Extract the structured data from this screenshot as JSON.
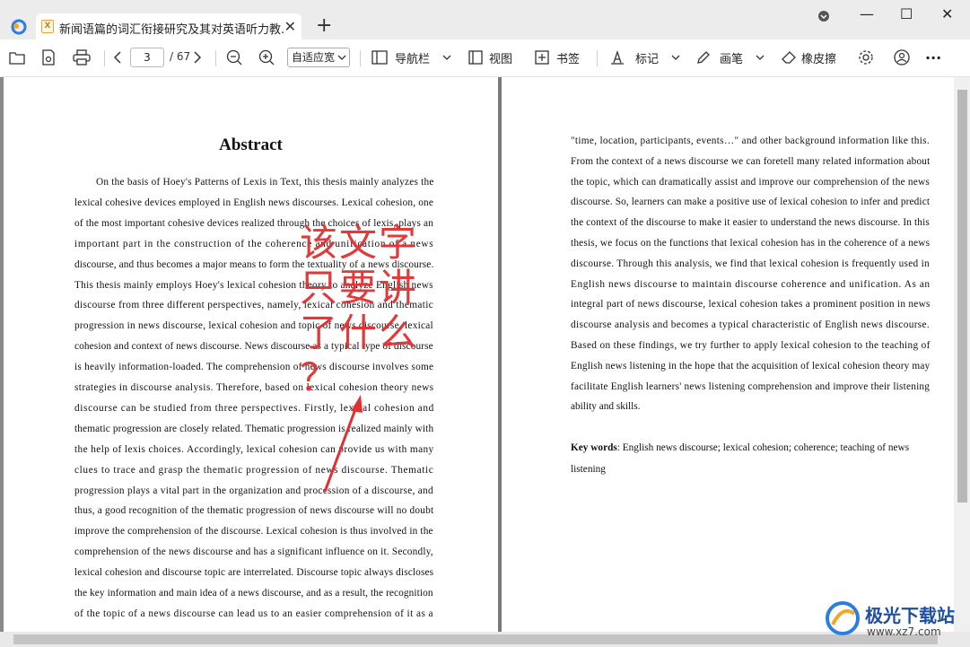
{
  "app": {
    "logo": "app-logo-icon"
  },
  "tab": {
    "title": "新闻语篇的词汇衔接研究及其对英语听力教...",
    "close": "✕",
    "icon_letter": "X"
  },
  "new_tab": "+",
  "window": {
    "theme": "▾",
    "minimize": "—",
    "maximize": "☐",
    "close": "✕"
  },
  "toolbar": {
    "page_current": "3",
    "page_total": "/ 67",
    "zoom_mode": "自适应宽",
    "navigation_label": "导航栏",
    "view_label": "视图",
    "bookmark_label": "书签",
    "mark_label": "标记",
    "pen_label": "画笔",
    "eraser_label": "橡皮擦",
    "more": "···"
  },
  "left_page": {
    "title": "Abstract",
    "lines": [
      "On the basis of Hoey's Patterns of Lexis in Text, this thesis mainly analyzes the",
      "lexical cohesive devices employed in English news discourses. Lexical cohesion, one",
      "of the most important cohesive devices realized through the choices of lexis, plays an",
      "important part in the construction of the coherence and unification of a news",
      "discourse, and thus becomes a major means to form the textuality of a news discourse.",
      "This thesis mainly employs Hoey's lexical cohesion theory to analyze English news",
      "discourse from three different perspectives, namely, lexical cohesion and thematic",
      "progression in news discourse, lexical cohesion and topic of news discourse, lexical",
      "cohesion and context of news discourse. News discourse as a typical type of discourse",
      "is heavily information-loaded. The comprehension of news discourse involves some",
      "strategies in discourse analysis. Therefore, based on lexical cohesion theory news",
      "discourse can be studied from three perspectives. Firstly, lexical cohesion and",
      "thematic progression are closely related. Thematic progression is realized mainly with",
      "the help of lexis choices. Accordingly, lexical cohesion can provide us with many",
      "clues to trace and grasp the thematic progression of news discourse. Thematic",
      "progression plays a vital part in the organization and procession of a discourse, and",
      "thus, a good recognition of the thematic progression of news discourse will no doubt",
      "improve the comprehension of the discourse. Lexical cohesion is thus involved in the",
      "comprehension of the news discourse and has a significant influence on it. Secondly,",
      "lexical cohesion and discourse topic are interrelated. Discourse topic always discloses",
      "the key information and main idea of a news discourse, and as a result, the recognition",
      "of the topic of a news discourse can lead us to an easier comprehension of it as a"
    ],
    "annotation": [
      "该文字",
      "只要讲",
      "了什么",
      "？"
    ]
  },
  "right_page": {
    "lines": [
      "\"time, location, participants, events…\" and other background information like this.",
      "From the context of a news discourse we can foretell many related information about",
      "the topic, which can dramatically assist and improve our comprehension of the news",
      "discourse. So, learners can make a positive use of lexical cohesion to infer and predict",
      "the context of the discourse to make it easier to understand the news discourse. In this",
      "thesis, we focus on the functions that lexical cohesion has in the coherence of a news",
      "discourse. Through this analysis, we find that lexical cohesion is frequently used in",
      "English news discourse to maintain discourse coherence and unification. As an",
      "integral part of news discourse, lexical cohesion takes a prominent position in news",
      "discourse analysis and becomes a typical characteristic of English news discourse.",
      "Based on these findings, we try further to apply lexical cohesion to the teaching of",
      "English news listening in the hope that the acquisition of lexical cohesion theory may",
      "facilitate English learners' news listening comprehension and improve their listening",
      "ability and skills."
    ],
    "keywords_label": "Key words",
    "keywords": ": English news discourse; lexical cohesion; coherence; teaching of news",
    "keywords_cont": "listening"
  },
  "watermark": {
    "brand": "极光下载站",
    "url": "www.xz7.com"
  },
  "colors": {
    "annotation": "#e03030",
    "accent": "#1a73e8"
  }
}
